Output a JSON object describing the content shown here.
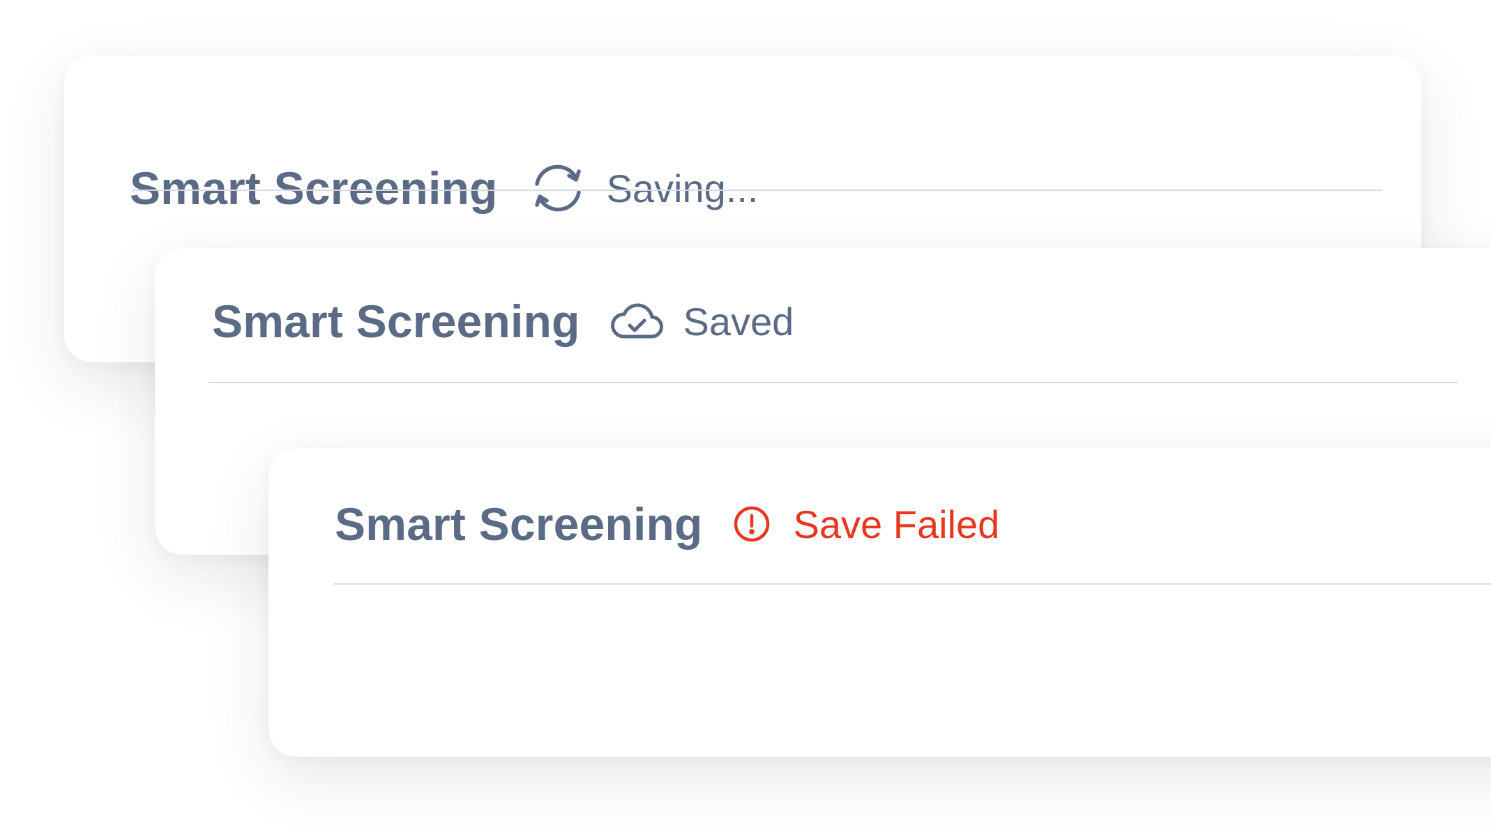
{
  "cards": [
    {
      "state": "saving",
      "title": "Smart Screening",
      "status_icon": "sync-icon",
      "status_text": "Saving...",
      "status_color": "#5c6b85"
    },
    {
      "state": "saved",
      "title": "Smart Screening",
      "status_icon": "cloud-check-icon",
      "status_text": "Saved",
      "status_color": "#5c6b85"
    },
    {
      "state": "failed",
      "title": "Smart Screening",
      "status_icon": "alert-circle-icon",
      "status_text": "Save Failed",
      "status_color": "#e8371f"
    }
  ],
  "colors": {
    "title": "#5c6b85",
    "divider": "#d7dbe1",
    "error": "#e8371f",
    "card_background": "#ffffff"
  }
}
